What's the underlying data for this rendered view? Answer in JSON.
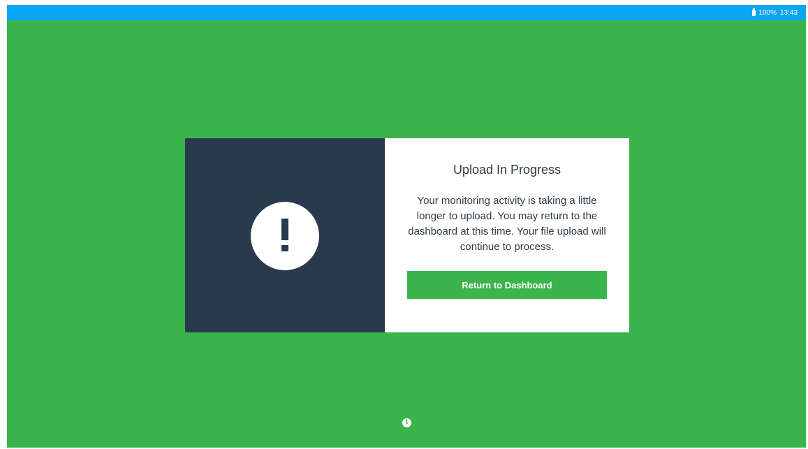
{
  "status_bar": {
    "battery": "100%",
    "time": "13:43",
    "icon": "battery-icon"
  },
  "header": {
    "faint_subtitle": ""
  },
  "modal": {
    "icon": "exclamation-icon",
    "title": "Upload In Progress",
    "message": "Your monitoring activity is taking a little longer to upload. You may return to the dashboard at this time. Your file upload will continue to process.",
    "button_label": "Return to Dashboard"
  },
  "footer": {
    "info_icon": "info-icon",
    "info_glyph": "i"
  },
  "colors": {
    "background": "#3bb44b",
    "status_bar": "#0aa5f3",
    "panel_dark": "#2a3a4d",
    "panel_light": "#ffffff",
    "button": "#3bb44b"
  }
}
